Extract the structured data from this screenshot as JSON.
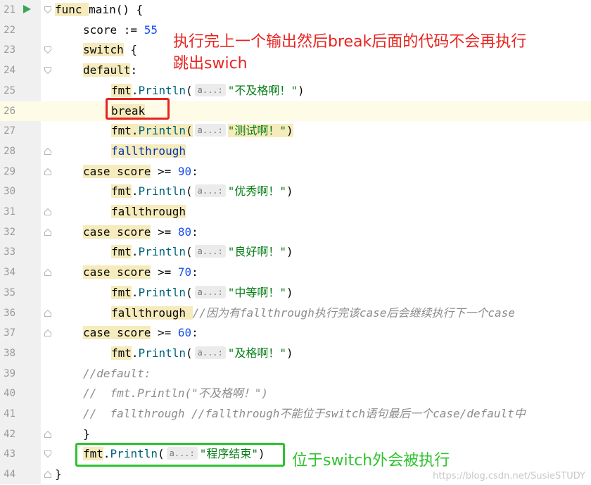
{
  "editor": {
    "lines": [
      {
        "no": "21",
        "t": [
          [
            "kw",
            "func "
          ],
          [
            "p",
            "main() {"
          ]
        ]
      },
      {
        "no": "22",
        "t": [
          [
            "p",
            "score := "
          ],
          [
            "num",
            "55"
          ]
        ]
      },
      {
        "no": "23",
        "t": [
          [
            "kw",
            "switch"
          ],
          [
            "p",
            " {"
          ]
        ]
      },
      {
        "no": "24",
        "t": [
          [
            "kw",
            "default"
          ],
          [
            "p",
            ":"
          ]
        ]
      },
      {
        "no": "25",
        "t": [
          [
            "pkgw",
            "fmt"
          ],
          [
            "p",
            "."
          ],
          [
            "fn",
            "Println"
          ],
          [
            "p",
            "("
          ],
          [
            "hint",
            "a...:"
          ],
          [
            "str",
            "\"不及格啊！\""
          ],
          [
            "p",
            ")"
          ]
        ]
      },
      {
        "no": "26",
        "t": [
          [
            "kw",
            "break"
          ]
        ]
      },
      {
        "no": "27",
        "t": [
          [
            "pkgw",
            "fmt"
          ],
          [
            "pw",
            "."
          ],
          [
            "fnw",
            "Println"
          ],
          [
            "pw",
            "("
          ],
          [
            "hint",
            "a...:"
          ],
          [
            "strw",
            "\"测试啊！\""
          ],
          [
            "pw",
            ")"
          ]
        ]
      },
      {
        "no": "28",
        "t": [
          [
            "kww",
            "fallthrough"
          ]
        ]
      },
      {
        "no": "29",
        "t": [
          [
            "kw",
            "case "
          ],
          [
            "pw",
            "score"
          ],
          [
            "p",
            " >= "
          ],
          [
            "num",
            "90"
          ],
          [
            "p",
            ":"
          ]
        ]
      },
      {
        "no": "30",
        "t": [
          [
            "pkgw",
            "fmt"
          ],
          [
            "p",
            "."
          ],
          [
            "fn",
            "Println"
          ],
          [
            "p",
            "("
          ],
          [
            "hint",
            "a...:"
          ],
          [
            "str",
            "\"优秀啊！\""
          ],
          [
            "p",
            ")"
          ]
        ]
      },
      {
        "no": "31",
        "t": [
          [
            "kw",
            "fallthrough"
          ]
        ]
      },
      {
        "no": "32",
        "t": [
          [
            "kw",
            "case "
          ],
          [
            "pw",
            "score"
          ],
          [
            "p",
            " >= "
          ],
          [
            "num",
            "80"
          ],
          [
            "p",
            ":"
          ]
        ]
      },
      {
        "no": "33",
        "t": [
          [
            "pkgw",
            "fmt"
          ],
          [
            "p",
            "."
          ],
          [
            "fn",
            "Println"
          ],
          [
            "p",
            "("
          ],
          [
            "hint",
            "a...:"
          ],
          [
            "str",
            "\"良好啊！\""
          ],
          [
            "p",
            ")"
          ]
        ]
      },
      {
        "no": "34",
        "t": [
          [
            "kw",
            "case "
          ],
          [
            "pw",
            "score"
          ],
          [
            "p",
            " >= "
          ],
          [
            "num",
            "70"
          ],
          [
            "p",
            ":"
          ]
        ]
      },
      {
        "no": "35",
        "t": [
          [
            "pkgw",
            "fmt"
          ],
          [
            "p",
            "."
          ],
          [
            "fn",
            "Println"
          ],
          [
            "p",
            "("
          ],
          [
            "hint",
            "a...:"
          ],
          [
            "str",
            "\"中等啊！\""
          ],
          [
            "p",
            ")"
          ]
        ]
      },
      {
        "no": "36",
        "t": [
          [
            "kw",
            "fallthrough "
          ],
          [
            "cm",
            "//因为有fallthrough执行完该case后会继续执行下一个case"
          ]
        ]
      },
      {
        "no": "37",
        "t": [
          [
            "kw",
            "case "
          ],
          [
            "pw",
            "score"
          ],
          [
            "p",
            " >= "
          ],
          [
            "num",
            "60"
          ],
          [
            "p",
            ":"
          ]
        ]
      },
      {
        "no": "38",
        "t": [
          [
            "pkgw",
            "fmt"
          ],
          [
            "p",
            "."
          ],
          [
            "fn",
            "Println"
          ],
          [
            "p",
            "("
          ],
          [
            "hint",
            "a...:"
          ],
          [
            "str",
            "\"及格啊！\""
          ],
          [
            "p",
            ")"
          ]
        ]
      },
      {
        "no": "39",
        "t": [
          [
            "cm",
            "//default:"
          ]
        ]
      },
      {
        "no": "40",
        "t": [
          [
            "cm",
            "//  fmt.Println(\"不及格啊！\")"
          ]
        ]
      },
      {
        "no": "41",
        "t": [
          [
            "cm",
            "//  fallthrough //fallthrough不能位于switch语句最后一个case/default中"
          ]
        ]
      },
      {
        "no": "42",
        "t": [
          [
            "p",
            "}"
          ]
        ]
      },
      {
        "no": "43",
        "t": [
          [
            "pkgw",
            "fmt"
          ],
          [
            "p",
            "."
          ],
          [
            "fn",
            "Println"
          ],
          [
            "p",
            "("
          ],
          [
            "hint",
            "a...:"
          ],
          [
            "str",
            "\"程序结束\""
          ],
          [
            "p",
            ")"
          ]
        ]
      },
      {
        "no": "44",
        "t": [
          [
            "p",
            "}"
          ]
        ]
      }
    ]
  },
  "annotations": {
    "red_note": "执行完上一个输出然后break后面的代码不会再执行\n跳出swich",
    "green_note": "位于switch外会被执行",
    "red_color": "#e8231f",
    "green_color": "#2ec22e"
  },
  "watermark": "https://blog.csdn.net/SusieSTUDY"
}
